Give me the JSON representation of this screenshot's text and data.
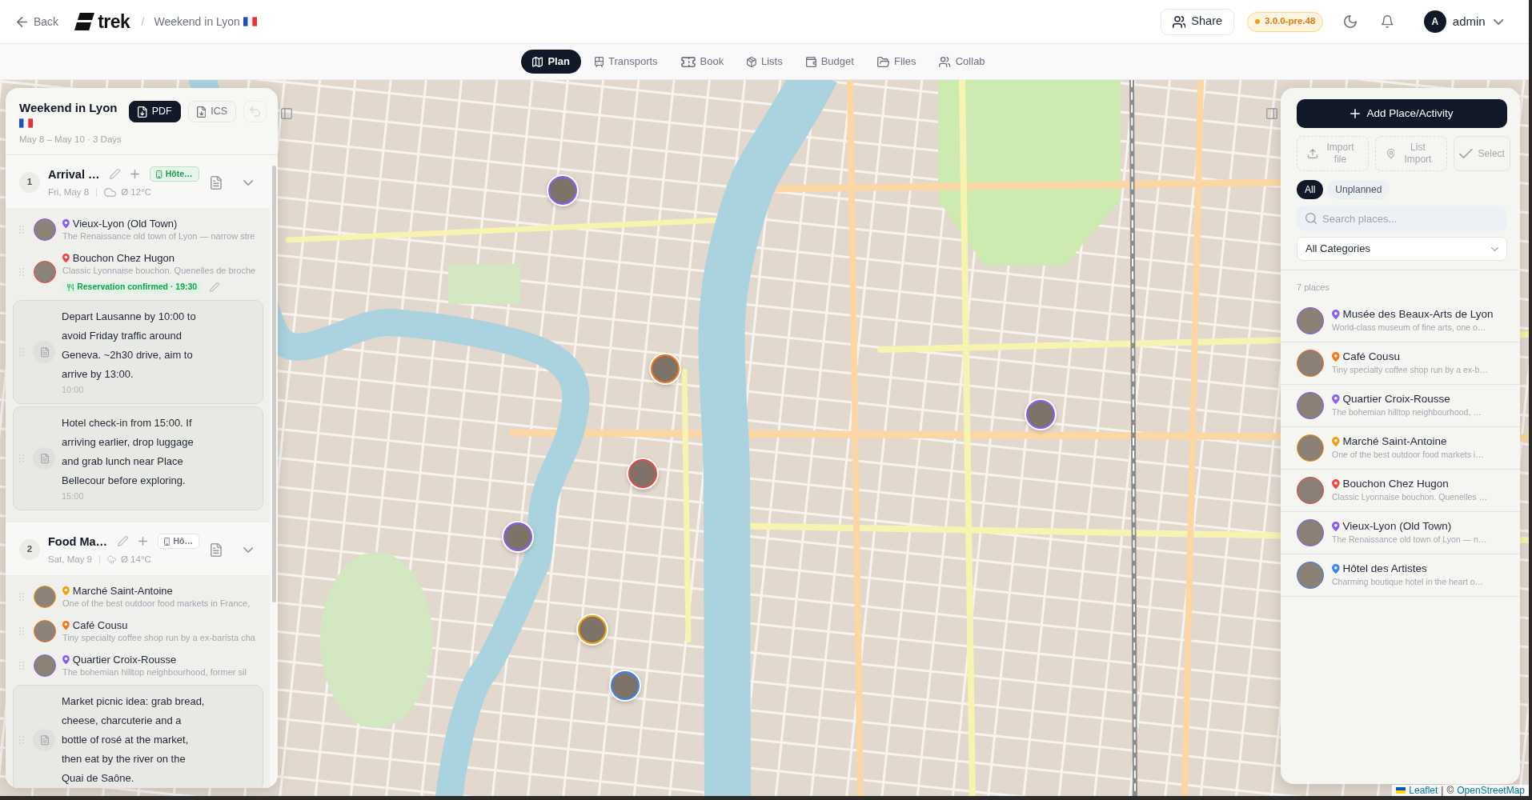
{
  "header": {
    "back": "Back",
    "logo": "trek",
    "separator": "/",
    "trip_title": "Weekend in Lyon",
    "share": "Share",
    "version": "3.0.0-pre.48",
    "user": {
      "initial": "A",
      "name": "admin"
    }
  },
  "tabs": [
    {
      "label": "Plan",
      "selected": true
    },
    {
      "label": "Transports",
      "selected": false
    },
    {
      "label": "Book",
      "selected": false
    },
    {
      "label": "Lists",
      "selected": false
    },
    {
      "label": "Budget",
      "selected": false
    },
    {
      "label": "Files",
      "selected": false
    },
    {
      "label": "Collab",
      "selected": false
    }
  ],
  "trip_panel": {
    "title": "Weekend in Lyon",
    "dates": "May 8 – May 10 · 3 Days",
    "exports": [
      {
        "label": "PDF",
        "primary": true
      },
      {
        "label": "ICS",
        "primary": false
      }
    ],
    "undo": {
      "disabled": true
    },
    "days": [
      {
        "number": "1",
        "title": "Arrival …",
        "date": "Fri, May 8",
        "weather": {
          "kind": "cloud",
          "temp": "Ø 12°C"
        },
        "accommodation": {
          "label": "Hôte…",
          "confirmed": true
        },
        "expanded": true,
        "items": [
          {
            "kind": "place",
            "name": "Vieux-Lyon (Old Town)",
            "description": "The Renaissance old town of Lyon — narrow stre",
            "color": "#8b5cf6"
          },
          {
            "kind": "place",
            "name": "Bouchon Chez Hugon",
            "description": "Classic Lyonnaise bouchon. Quenelles de broche",
            "color": "#ef4444",
            "reservation": "Reservation confirmed · 19:30"
          },
          {
            "kind": "note",
            "text": "Depart Lausanne by 10:00 to avoid Friday traffic around Geneva. ~2h30 drive, aim to arrive by 13:00.",
            "time": "10:00"
          },
          {
            "kind": "note",
            "text": "Hotel check-in from 15:00. If arriving earlier, drop luggage and grab lunch near Place Bellecour before exploring.",
            "time": "15:00"
          }
        ]
      },
      {
        "number": "2",
        "title": "Food Ma…",
        "date": "Sat, May 9",
        "weather": {
          "kind": "rain",
          "temp": "Ø 14°C"
        },
        "accommodation": {
          "label": "Hô…",
          "confirmed": false
        },
        "expanded": true,
        "items": [
          {
            "kind": "place",
            "name": "Marché Saint-Antoine",
            "description": "One of the best outdoor food markets in France,",
            "color": "#f59e0b"
          },
          {
            "kind": "place",
            "name": "Café Cousu",
            "description": "Tiny specialty coffee shop run by a ex-barista cha",
            "color": "#f97316"
          },
          {
            "kind": "place",
            "name": "Quartier Croix-Rousse",
            "description": "The bohemian hilltop neighbourhood, former sil",
            "color": "#8b5cf6"
          },
          {
            "kind": "note",
            "text": "Market picnic idea: grab bread, cheese, charcuterie and a bottle of rosé at the market, then eat by the river on the Quai de Saône."
          }
        ]
      }
    ]
  },
  "places_panel": {
    "add_button": "Add Place/Activity",
    "actions": [
      {
        "label": "Import file",
        "kind": "import"
      },
      {
        "label": "List Import",
        "kind": "list"
      },
      {
        "label": "Select",
        "kind": "select"
      }
    ],
    "filters": [
      {
        "label": "All",
        "selected": true
      },
      {
        "label": "Unplanned",
        "selected": false
      }
    ],
    "search": {
      "placeholder": "Search places..."
    },
    "category_select": "All Categories",
    "count": "7 places",
    "places": [
      {
        "name": "Musée des Beaux-Arts de Lyon",
        "description": "World-class museum of fine arts, one o…",
        "color": "#8b5cf6"
      },
      {
        "name": "Café Cousu",
        "description": "Tiny specialty coffee shop run by a ex-b…",
        "color": "#f97316"
      },
      {
        "name": "Quartier Croix-Rousse",
        "description": "The bohemian hilltop neighbourhood, …",
        "color": "#8b5cf6"
      },
      {
        "name": "Marché Saint-Antoine",
        "description": "One of the best outdoor food markets i…",
        "color": "#f59e0b"
      },
      {
        "name": "Bouchon Chez Hugon",
        "description": "Classic Lyonnaise bouchon. Quenelles …",
        "color": "#ef4444"
      },
      {
        "name": "Vieux-Lyon (Old Town)",
        "description": "The Renaissance old town of Lyon — n…",
        "color": "#8b5cf6"
      },
      {
        "name": "Hôtel des Artistes",
        "description": "Charming boutique hotel in the heart o…",
        "color": "#3b82f6"
      }
    ]
  },
  "map": {
    "attribution": {
      "library": "Leaflet",
      "separator": "|",
      "copyright": "©",
      "source": "OpenStreetMap"
    }
  }
}
